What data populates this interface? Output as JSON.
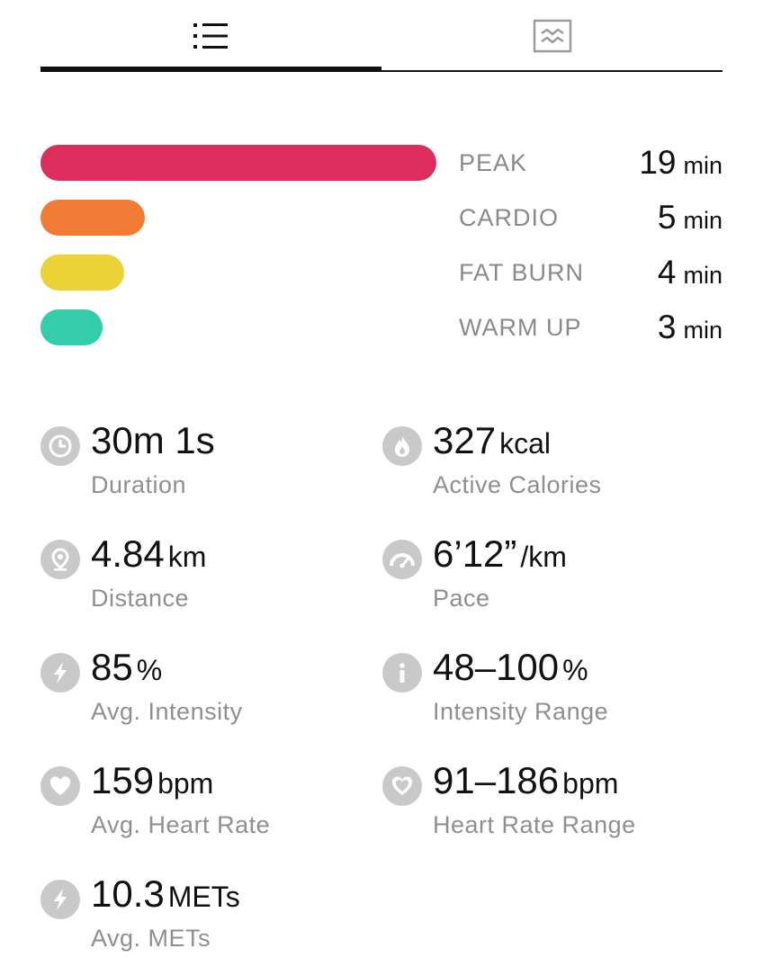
{
  "tabs": [
    {
      "icon": "list-icon",
      "active": true
    },
    {
      "icon": "chart-icon",
      "active": false
    }
  ],
  "zones": [
    {
      "label": "PEAK",
      "minutes": 19,
      "unit": "min",
      "color": "#DC2D5C"
    },
    {
      "label": "CARDIO",
      "minutes": 5,
      "unit": "min",
      "color": "#F07B35"
    },
    {
      "label": "FAT BURN",
      "minutes": 4,
      "unit": "min",
      "color": "#EBD236"
    },
    {
      "label": "WARM UP",
      "minutes": 3,
      "unit": "min",
      "color": "#34CDAA"
    }
  ],
  "stats": {
    "duration": {
      "value": "30m 1s",
      "unit": "",
      "label": "Duration",
      "icon": "clock-icon"
    },
    "calories": {
      "value": "327",
      "unit": "kcal",
      "label": "Active Calories",
      "icon": "flame-icon"
    },
    "distance": {
      "value": "4.84",
      "unit": "km",
      "label": "Distance",
      "icon": "location-pin-icon"
    },
    "pace": {
      "value": "6’12”",
      "unit": "/km",
      "label": "Pace",
      "icon": "speedometer-icon"
    },
    "intensity": {
      "value": "85",
      "unit": "%",
      "label": "Avg. Intensity",
      "icon": "lightning-icon"
    },
    "intensity_range": {
      "value": "48–100",
      "unit": "%",
      "label": "Intensity Range",
      "icon": "info-icon"
    },
    "heart_rate": {
      "value": "159",
      "unit": "bpm",
      "label": "Avg. Heart Rate",
      "icon": "heart-icon"
    },
    "heart_rate_range": {
      "value": "91–186",
      "unit": "bpm",
      "label": "Heart Rate Range",
      "icon": "heart-range-icon"
    },
    "mets": {
      "value": "10.3",
      "unit": "METs",
      "label": "Avg. METs",
      "icon": "lightning-icon"
    }
  },
  "colors": {
    "icon_gray": "#C9C9C9",
    "label_gray": "#8A8A8A"
  }
}
